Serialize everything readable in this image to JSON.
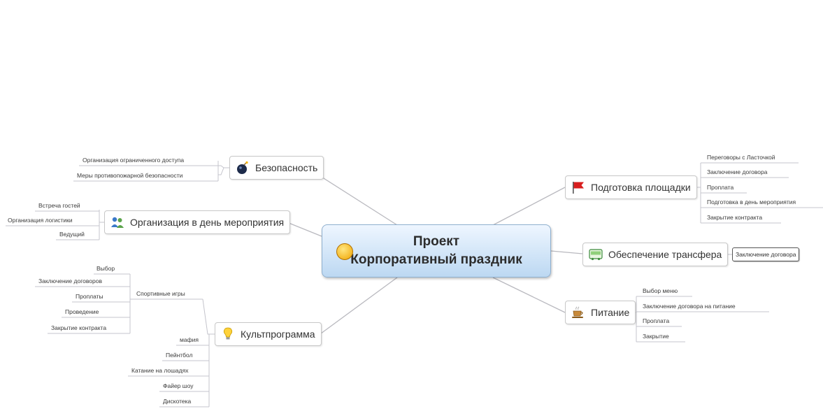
{
  "central": {
    "line1": "Проект",
    "line2": "Корпоративный праздник"
  },
  "branches": {
    "bezopasnost": {
      "label": "Безопасность",
      "items": [
        "Организация ограниченного доступа",
        "Меры противопожарной безопасности"
      ]
    },
    "organizaciya": {
      "label": "Организация в день мероприятия",
      "items": [
        "Встреча гостей",
        "Организация логистики",
        "Ведущий"
      ]
    },
    "kultprogramma": {
      "label": "Культпрограмма",
      "sport": {
        "label": "Спортивные игры",
        "items": [
          "Выбор",
          "Заключение договоров",
          "Проплаты",
          "Проведение",
          "Закрытие контракта"
        ]
      },
      "items": [
        "мафия",
        "Пейнтбол",
        "Катание на лошадях",
        "Файер шоу",
        "Дискотека"
      ]
    },
    "podgotovka": {
      "label": "Подготовка площадки",
      "items": [
        "Переговоры с Ласточкой",
        "Заключение договора",
        "Проплата",
        "Подготовка в день мероприятия",
        "Закрытие контракта"
      ]
    },
    "transfer": {
      "label": "Обеспечение трансфера",
      "items": [
        "Заключение договора"
      ]
    },
    "pitanie": {
      "label": "Питание",
      "items": [
        "Выбор меню",
        "Заключение договора на питание",
        "Проплата",
        "Закрытие"
      ]
    }
  },
  "icons": {
    "bezopasnost": "bomb-icon",
    "organizaciya": "people-icon",
    "kultprogramma": "lightbulb-icon",
    "podgotovka": "red-flag-icon",
    "transfer": "bus-icon",
    "pitanie": "coffee-cup-icon",
    "central": "smiley-icon"
  }
}
